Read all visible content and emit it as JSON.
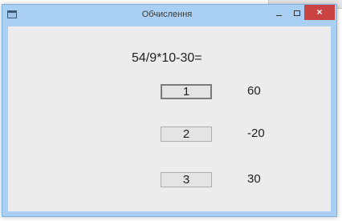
{
  "window": {
    "title": "Обчислення",
    "close_glyph": "×",
    "minimize_icon": "minimize-icon",
    "maximize_icon": "maximize-icon",
    "app_icon": "app-icon"
  },
  "task": {
    "expression": "54/9*10-30="
  },
  "answers": [
    {
      "button_label": "1",
      "value": "60",
      "focused": true
    },
    {
      "button_label": "2",
      "value": "-20",
      "focused": false
    },
    {
      "button_label": "3",
      "value": "30",
      "focused": false
    }
  ],
  "colors": {
    "titlebar": "#a9d0f2",
    "close_button": "#c94343",
    "client_background": "#ececec",
    "button_background": "#e4e4e4"
  }
}
